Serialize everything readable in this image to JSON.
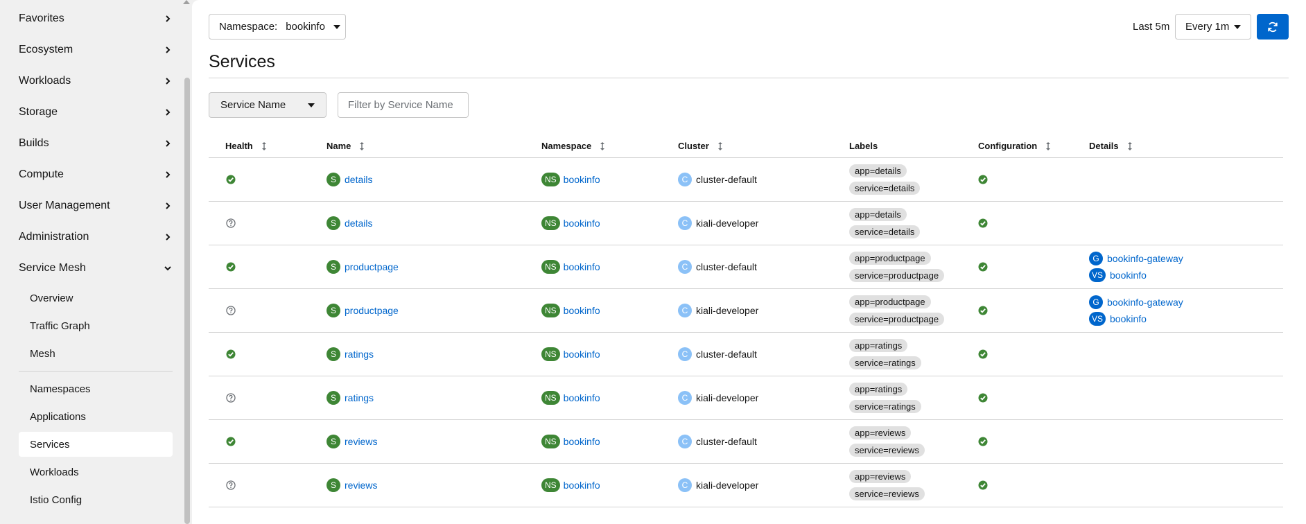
{
  "sidebar": {
    "items": [
      {
        "label": "Favorites",
        "expanded": false
      },
      {
        "label": "Ecosystem",
        "expanded": false
      },
      {
        "label": "Workloads",
        "expanded": false
      },
      {
        "label": "Storage",
        "expanded": false
      },
      {
        "label": "Builds",
        "expanded": false
      },
      {
        "label": "Compute",
        "expanded": false
      },
      {
        "label": "User Management",
        "expanded": false
      },
      {
        "label": "Administration",
        "expanded": false
      },
      {
        "label": "Service Mesh",
        "expanded": true
      }
    ],
    "sub_items": [
      "Overview",
      "Traffic Graph",
      "Mesh",
      "Namespaces",
      "Applications",
      "Services",
      "Workloads",
      "Istio Config"
    ],
    "active_sub": "Services"
  },
  "toolbar": {
    "namespace_label": "Namespace:",
    "namespace_value": "bookinfo",
    "time_range": "Last 5m",
    "refresh_interval": "Every 1m"
  },
  "page": {
    "title": "Services"
  },
  "filter": {
    "type": "Service Name",
    "placeholder": "Filter by Service Name"
  },
  "table": {
    "columns": [
      "Health",
      "Name",
      "Namespace",
      "Cluster",
      "Labels",
      "Configuration",
      "Details"
    ],
    "rows": [
      {
        "health": "healthy",
        "name": "details",
        "namespace": "bookinfo",
        "cluster": "cluster-default",
        "labels": [
          "app=details",
          "service=details"
        ],
        "config": "valid",
        "details": []
      },
      {
        "health": "unknown",
        "name": "details",
        "namespace": "bookinfo",
        "cluster": "kiali-developer",
        "labels": [
          "app=details",
          "service=details"
        ],
        "config": "valid",
        "details": []
      },
      {
        "health": "healthy",
        "name": "productpage",
        "namespace": "bookinfo",
        "cluster": "cluster-default",
        "labels": [
          "app=productpage",
          "service=productpage"
        ],
        "config": "valid",
        "details": [
          {
            "badge": "G",
            "text": "bookinfo-gateway"
          },
          {
            "badge": "VS",
            "text": "bookinfo"
          }
        ]
      },
      {
        "health": "unknown",
        "name": "productpage",
        "namespace": "bookinfo",
        "cluster": "kiali-developer",
        "labels": [
          "app=productpage",
          "service=productpage"
        ],
        "config": "valid",
        "details": [
          {
            "badge": "G",
            "text": "bookinfo-gateway"
          },
          {
            "badge": "VS",
            "text": "bookinfo"
          }
        ]
      },
      {
        "health": "healthy",
        "name": "ratings",
        "namespace": "bookinfo",
        "cluster": "cluster-default",
        "labels": [
          "app=ratings",
          "service=ratings"
        ],
        "config": "valid",
        "details": []
      },
      {
        "health": "unknown",
        "name": "ratings",
        "namespace": "bookinfo",
        "cluster": "kiali-developer",
        "labels": [
          "app=ratings",
          "service=ratings"
        ],
        "config": "valid",
        "details": []
      },
      {
        "health": "healthy",
        "name": "reviews",
        "namespace": "bookinfo",
        "cluster": "cluster-default",
        "labels": [
          "app=reviews",
          "service=reviews"
        ],
        "config": "valid",
        "details": []
      },
      {
        "health": "unknown",
        "name": "reviews",
        "namespace": "bookinfo",
        "cluster": "kiali-developer",
        "labels": [
          "app=reviews",
          "service=reviews"
        ],
        "config": "valid",
        "details": []
      }
    ]
  },
  "badges": {
    "service": "S",
    "namespace": "NS",
    "cluster": "C"
  },
  "colors": {
    "accent": "#0066cc",
    "success": "#3e8635",
    "cluster_badge": "#8bc1f7",
    "unknown": "#6a6e73"
  }
}
